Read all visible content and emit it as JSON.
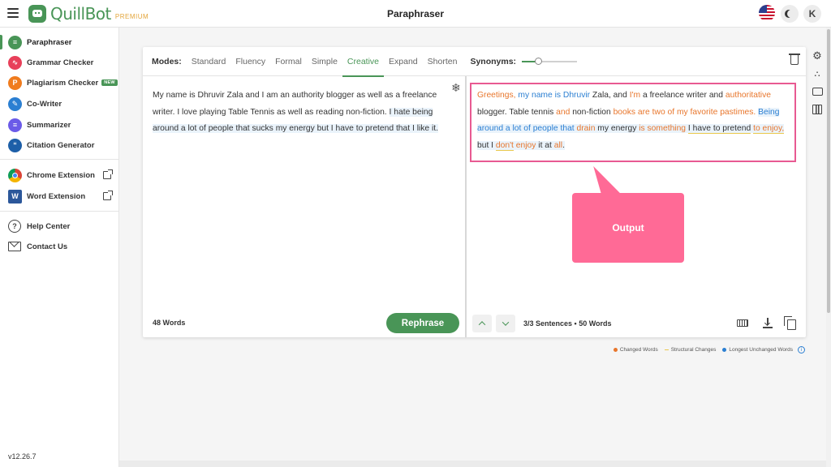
{
  "app": {
    "brand": "QuillBot",
    "premium": "PREMIUM",
    "page_title": "Paraphraser",
    "avatar_initial": "K"
  },
  "sidebar": {
    "items": [
      {
        "label": "Paraphraser",
        "color": "#499557"
      },
      {
        "label": "Grammar Checker",
        "color": "#e8405a"
      },
      {
        "label": "Plagiarism Checker",
        "color": "#f07c1e",
        "badge": "NEW"
      },
      {
        "label": "Co-Writer",
        "color": "#2b7fd2"
      },
      {
        "label": "Summarizer",
        "color": "#6b5be8"
      },
      {
        "label": "Citation Generator",
        "color": "#1d5fa8"
      }
    ],
    "extensions": [
      {
        "label": "Chrome Extension"
      },
      {
        "label": "Word Extension"
      }
    ],
    "help": {
      "label": "Help Center"
    },
    "contact": {
      "label": "Contact Us"
    },
    "version": "v12.26.7"
  },
  "toolbar": {
    "modes_label": "Modes:",
    "modes": [
      "Standard",
      "Fluency",
      "Formal",
      "Simple",
      "Creative",
      "Expand",
      "Shorten"
    ],
    "active_mode": "Creative",
    "synonyms_label": "Synonyms:",
    "synonyms_level": 0.3
  },
  "input": {
    "text_plain": "My name is Dhruvir Zala and I am an authority blogger as well as a freelance writer. I love playing Table Tennis as well as reading non-fiction. ",
    "text_highlight": "I hate being around a lot of people that sucks my energy but I have to pretend that I like it.",
    "word_count": "48 Words",
    "rephrase_label": "Rephrase"
  },
  "output": {
    "segments": [
      {
        "t": "Greetings, ",
        "c": "orange"
      },
      {
        "t": "my name is Dhruvir",
        "c": "blue"
      },
      {
        "t": " Zala, and ",
        "c": ""
      },
      {
        "t": "I'm",
        "c": "orange"
      },
      {
        "t": " a freelance writer and ",
        "c": ""
      },
      {
        "t": "authoritative",
        "c": "orange"
      },
      {
        "t": " blogger. Table tennis ",
        "c": ""
      },
      {
        "t": "and",
        "c": "orange"
      },
      {
        "t": " non-fiction ",
        "c": ""
      },
      {
        "t": "books are two of my favorite pastimes.",
        "c": "orange"
      },
      {
        "t": " ",
        "c": ""
      },
      {
        "t": "Being around a lot of people that",
        "c": "blue",
        "hl": true
      },
      {
        "t": " ",
        "c": "",
        "hl": true
      },
      {
        "t": "drain",
        "c": "orange",
        "hl": true
      },
      {
        "t": " my energy ",
        "c": "",
        "hl": true
      },
      {
        "t": "is something",
        "c": "orange",
        "hl": true
      },
      {
        "t": " ",
        "c": "",
        "hl": true
      },
      {
        "t": "I have to pretend",
        "c": "",
        "hl": true,
        "ul": true
      },
      {
        "t": " ",
        "c": "",
        "hl": true
      },
      {
        "t": "to enjoy,",
        "c": "orange",
        "hl": true,
        "ul": true
      },
      {
        "t": " but I ",
        "c": "",
        "hl": true
      },
      {
        "t": "don't",
        "c": "orange",
        "hl": true,
        "ul": true
      },
      {
        "t": " ",
        "c": "",
        "hl": true
      },
      {
        "t": "enjoy",
        "c": "orange",
        "hl": true
      },
      {
        "t": " it at ",
        "c": "",
        "hl": true
      },
      {
        "t": "all",
        "c": "orange",
        "hl": true
      },
      {
        "t": ".",
        "c": "",
        "hl": true
      }
    ],
    "sentences": "3/3 Sentences",
    "word_count": "50 Words",
    "callout_label": "Output"
  },
  "legend": {
    "changed": "Changed Words",
    "structural": "Structural Changes",
    "unchanged": "Longest Unchanged Words",
    "colors": {
      "changed": "#e8762c",
      "structural": "#e9c84b",
      "unchanged": "#2b7fd2"
    }
  },
  "icons": [
    "hamburger-icon",
    "us-flag-icon",
    "moon-icon",
    "snowflake-icon",
    "trash-icon",
    "gear-icon",
    "keyboard-icon",
    "download-icon",
    "copy-icon",
    "info-icon"
  ]
}
